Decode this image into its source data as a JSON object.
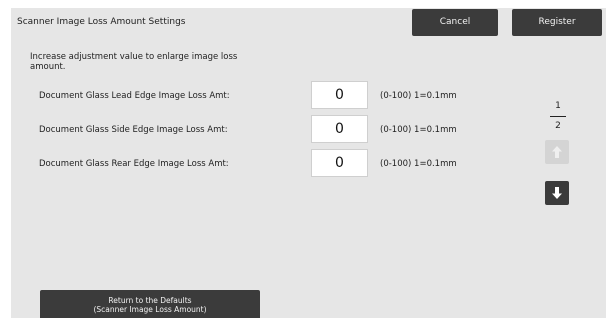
{
  "header": {
    "title": "Scanner Image Loss Amount Settings",
    "cancel_label": "Cancel",
    "register_label": "Register"
  },
  "instruction": "Increase adjustment value to enlarge image loss amount.",
  "settings": [
    {
      "label": "Document Glass Lead Edge Image Loss Amt:",
      "value": "0",
      "range": "(0-100) 1=0.1mm"
    },
    {
      "label": "Document Glass Side Edge Image Loss Amt:",
      "value": "0",
      "range": "(0-100) 1=0.1mm"
    },
    {
      "label": "Document Glass Rear Edge Image Loss Amt:",
      "value": "0",
      "range": "(0-100) 1=0.1mm"
    }
  ],
  "pager": {
    "current": "1",
    "total": "2",
    "up_icon": "arrow-up-icon",
    "down_icon": "arrow-down-icon"
  },
  "footer": {
    "defaults_line1": "Return to the Defaults",
    "defaults_line2": "(Scanner Image Loss Amount)"
  },
  "colors": {
    "panel_bg": "#e6e6e6",
    "button_dark": "#3b3b3b",
    "button_disabled": "#d4d4d4"
  }
}
